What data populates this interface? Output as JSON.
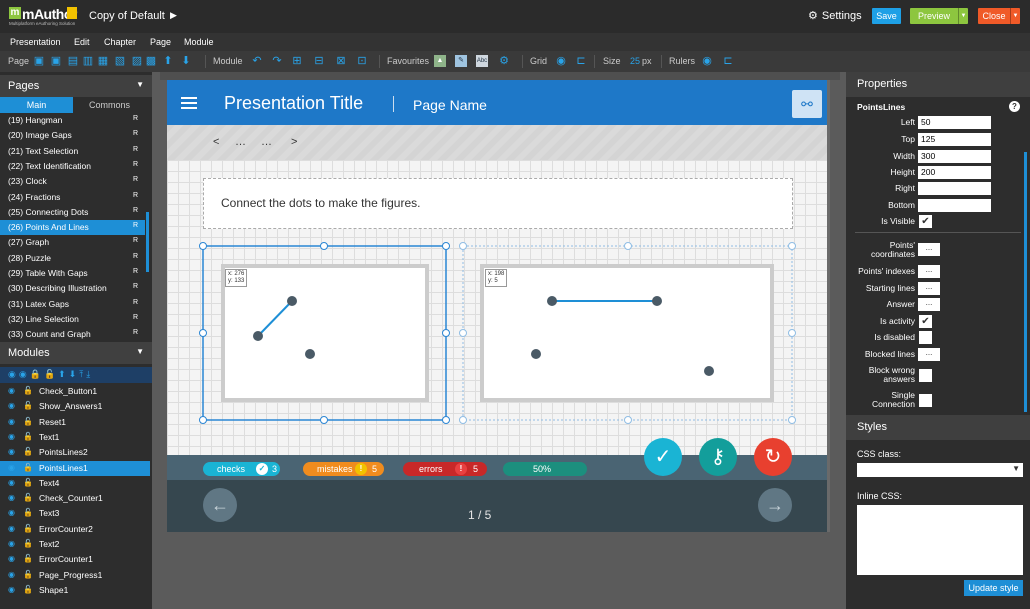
{
  "app": {
    "logo_text": "mAuthor",
    "logo_sub": "Multiplatform eAuthoring Solution",
    "doc_title": "Copy of Default",
    "settings": "Settings",
    "save": "Save",
    "preview": "Preview",
    "close": "Close"
  },
  "menu": [
    "Presentation",
    "Edit",
    "Chapter",
    "Page",
    "Module"
  ],
  "toolbar": {
    "page": "Page",
    "module": "Module",
    "favourites": "Favourites",
    "grid": "Grid",
    "size": "Size",
    "size_value": "25",
    "size_unit": "px",
    "rulers": "Rulers"
  },
  "pages": {
    "title": "Pages",
    "tabs": [
      "Main",
      "Commons"
    ],
    "items": [
      {
        "label": "(19) Hangman",
        "badge": "R"
      },
      {
        "label": "(20) Image Gaps",
        "badge": "R"
      },
      {
        "label": "(21) Text Selection",
        "badge": "R"
      },
      {
        "label": "(22) Text Identification",
        "badge": "R"
      },
      {
        "label": "(23) Clock",
        "badge": "R"
      },
      {
        "label": "(24) Fractions",
        "badge": "R"
      },
      {
        "label": "(25) Connecting Dots",
        "badge": "R"
      },
      {
        "label": "(26) Points And Lines",
        "badge": "R"
      },
      {
        "label": "(27) Graph",
        "badge": "R"
      },
      {
        "label": "(28) Puzzle",
        "badge": "R"
      },
      {
        "label": "(29) Table With Gaps",
        "badge": "R"
      },
      {
        "label": "(30) Describing Illustration",
        "badge": "R"
      },
      {
        "label": "(31) Latex Gaps",
        "badge": "R"
      },
      {
        "label": "(32) Line Selection",
        "badge": "R"
      },
      {
        "label": "(33) Count and Graph",
        "badge": "R"
      }
    ]
  },
  "modules": {
    "title": "Modules",
    "items": [
      "Check_Button1",
      "Show_Answers1",
      "Reset1",
      "Text1",
      "PointsLines2",
      "PointsLines1",
      "Text4",
      "Check_Counter1",
      "Text3",
      "ErrorCounter2",
      "Text2",
      "ErrorCounter1",
      "Page_Progress1",
      "Shape1"
    ]
  },
  "presentation": {
    "title": "Presentation Title",
    "page_name": "Page Name",
    "crumbs": [
      "<",
      "…",
      "…",
      ">"
    ],
    "instruction": "Connect the dots to make the figures.",
    "coord1": {
      "x": "x: 276",
      "y": "y: 133"
    },
    "coord2": {
      "x": "x: 198",
      "y": "y: 5"
    },
    "checks": {
      "label": "checks",
      "value": "3"
    },
    "mistakes": {
      "label": "mistakes",
      "value": "5"
    },
    "errors": {
      "label": "errors",
      "value": "5"
    },
    "progress": "50%",
    "page_counter": "1 / 5"
  },
  "properties": {
    "title": "Properties",
    "module_name": "PointsLines",
    "left_label": "Left",
    "left": "50",
    "top_label": "Top",
    "top": "125",
    "width_label": "Width",
    "width": "300",
    "height_label": "Height",
    "height": "200",
    "right_label": "Right",
    "right": "",
    "bottom_label": "Bottom",
    "bottom": "",
    "is_visible": "Is Visible",
    "points_coordinates": "Points' coordinates",
    "points_indexes": "Points' indexes",
    "starting_lines": "Starting lines",
    "answer": "Answer",
    "is_activity": "Is activity",
    "is_disabled": "Is disabled",
    "blocked_lines": "Blocked lines",
    "block_wrong": "Block wrong answers",
    "single_connection": "Single Connection",
    "dots": "..."
  },
  "styles": {
    "title": "Styles",
    "css_class": "CSS class:",
    "inline_css": "Inline CSS:",
    "update": "Update style"
  },
  "colors": {
    "accent": "#1e8fd6",
    "header": "#1e78c8",
    "check": "#1ab4d4",
    "key": "#139e9b",
    "reset": "#e8402f"
  }
}
